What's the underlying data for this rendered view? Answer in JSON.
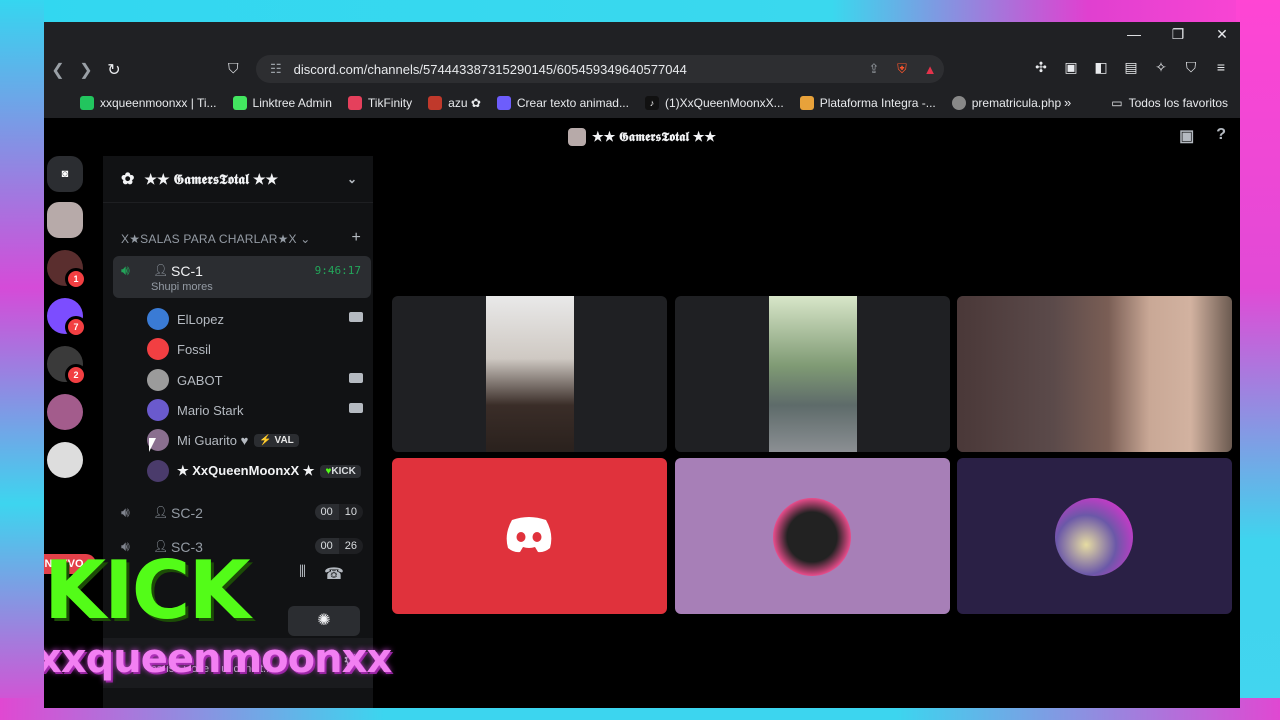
{
  "browser": {
    "url": "discord.com/channels/574443387315290145/605459349640577044",
    "bookmarks": [
      {
        "label": "xxqueenmoonxx | Ti...",
        "color": "#22c55e"
      },
      {
        "label": "Linktree Admin",
        "color": "#43e660"
      },
      {
        "label": "TikFinity",
        "color": "#e5405c"
      },
      {
        "label": "azu ✿",
        "color": "#c0392b"
      },
      {
        "label": "Crear texto animad...",
        "color": "#6d5dfc"
      },
      {
        "label": "(1)XxQueenMoonxX...",
        "color": "#111111"
      },
      {
        "label": "Plataforma Integra -...",
        "color": "#e8a23a"
      },
      {
        "label": "prematricula.php",
        "color": "#888888"
      }
    ],
    "bookmarks_more": "»",
    "bookmarks_folder": "Todos los favoritos"
  },
  "discord": {
    "top_title": "★★ 𝕲𝖆𝖒𝖊𝖗𝖘𝕿𝖔𝖙𝖆𝖑 ★★",
    "server_name": "★★ 𝕲𝖆𝖒𝖊𝖗𝖘𝕿𝖔𝖙𝖆𝖑 ★★",
    "category": "X★SALAS PARA CHARLAR★X",
    "nuevo": "NUEVO",
    "active_channel": {
      "name": "SC-1",
      "timer": "9:46:17",
      "status": "Shupi mores"
    },
    "members": [
      {
        "name": "ElLopez",
        "camera": true,
        "color": "#3a7bd5"
      },
      {
        "name": "Fossil",
        "camera": false,
        "color": "#f23f42"
      },
      {
        "name": "GABOT",
        "camera": true,
        "color": "#9b9b9b"
      },
      {
        "name": "Mario Stark",
        "camera": true,
        "color": "#6a5acd"
      },
      {
        "name": "Mi Guarito ♥",
        "tag": "VAL",
        "tag_mark": "⚡",
        "color": "#8a6f8f"
      },
      {
        "name": "★ XxQueenMoonxX ★",
        "tag": "KICK",
        "tag_mark": "♥",
        "color": "#4a3b6b"
      }
    ],
    "channel2": {
      "name": "SC-2",
      "count_left": "00",
      "count_right": "10"
    },
    "channel3": {
      "name": "SC-3",
      "count_left": "00",
      "count_right": "26"
    },
    "user_panel": {
      "status_line": "cause i love u uncondit...",
      "handle": "xxqueenmoonxx"
    },
    "kick_logo": "KICK"
  },
  "colors": {
    "discord_green": "#23a55a",
    "kick_green": "#53fc18",
    "frame_cyan": "#35d6f0",
    "frame_magenta": "#ff45d4"
  }
}
